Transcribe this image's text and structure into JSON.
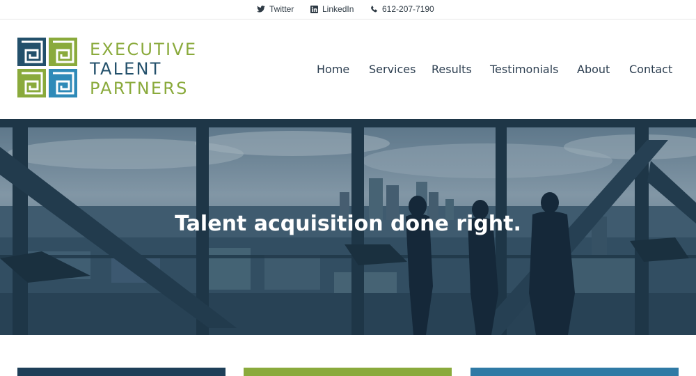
{
  "topbar": {
    "twitter": "Twitter",
    "linkedin": "LinkedIn",
    "phone": "612-207-7190"
  },
  "logo": {
    "line1": "EXECUTIVE",
    "line2": "TALENT",
    "line3": "PARTNERS"
  },
  "nav": {
    "items": [
      "Home",
      "Services",
      "Results",
      "Testimonials",
      "About",
      "Contact"
    ]
  },
  "hero": {
    "title": "Talent acquisition done right."
  },
  "colors": {
    "brand_green": "#8aaa3c",
    "brand_navy": "#23506b",
    "brand_blue": "#2e8ab8",
    "card1": "#1e3f58",
    "card2": "#8aaa3c",
    "card3": "#2f7aa5"
  },
  "icons": {
    "twitter": "twitter-icon",
    "linkedin": "linkedin-icon",
    "phone": "phone-icon"
  }
}
